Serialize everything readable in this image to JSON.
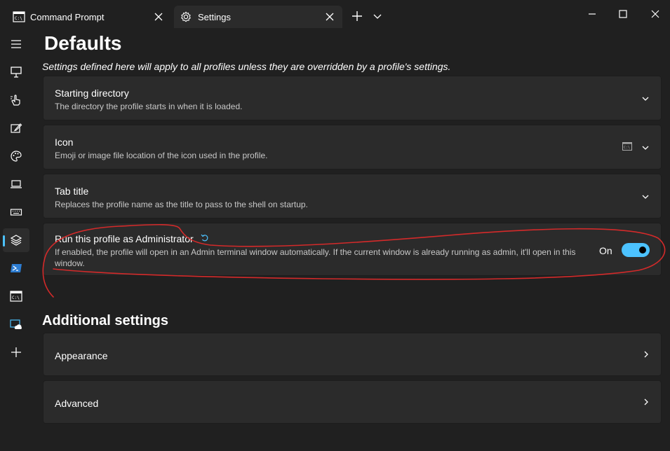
{
  "tabs": [
    {
      "label": "Command Prompt",
      "icon": "cmd-icon"
    },
    {
      "label": "Settings",
      "icon": "gear-icon"
    }
  ],
  "colors": {
    "accent": "#4cc2ff",
    "background": "#202020",
    "card": "#2b2b2b",
    "annotation": "#d42a2a"
  },
  "page": {
    "title": "Defaults",
    "description": "Settings defined here will apply to all profiles unless they are overridden by a profile's settings."
  },
  "settings": [
    {
      "title": "Starting directory",
      "description": "The directory the profile starts in when it is loaded."
    },
    {
      "title": "Icon",
      "description": "Emoji or image file location of the icon used in the profile."
    },
    {
      "title": "Tab title",
      "description": "Replaces the profile name as the title to pass to the shell on startup."
    },
    {
      "title": "Run this profile as Administrator",
      "description_line1": "If enabled, the profile will open in an Admin terminal window automatically. If the current window is already running as admin, it'll open in this",
      "description_line2": "window.",
      "toggle_label": "On",
      "toggle_on": true
    }
  ],
  "additional": {
    "title": "Additional settings",
    "items": [
      {
        "label": "Appearance"
      },
      {
        "label": "Advanced"
      }
    ]
  }
}
